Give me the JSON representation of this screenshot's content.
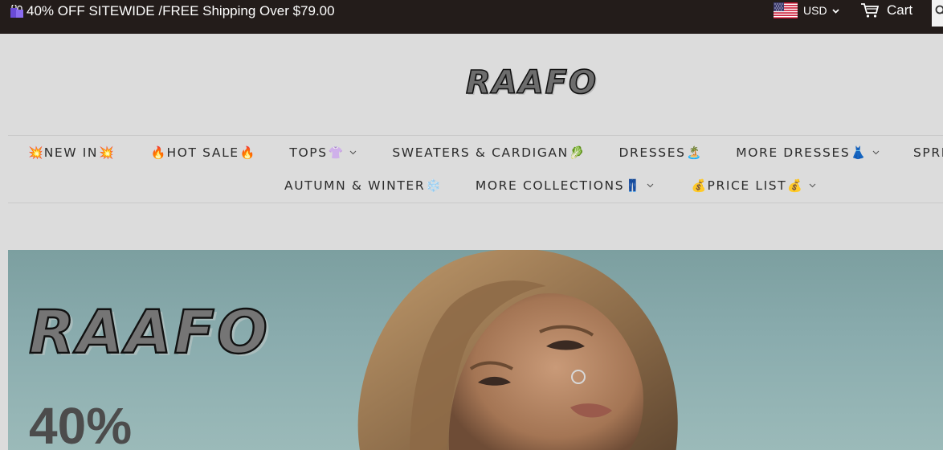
{
  "announcement": {
    "icon": "shopping-bags-icon",
    "text": "40% OFF SITEWIDE /FREE Shipping Over $79.00"
  },
  "currency": {
    "icon": "us-flag-icon",
    "code": "USD"
  },
  "cart": {
    "icon": "cart-icon",
    "label": "Cart"
  },
  "search": {
    "icon": "search-icon"
  },
  "brand": {
    "logo_text": "RAAFO"
  },
  "nav": {
    "row1": [
      {
        "pre": "💥",
        "label": "NEW IN",
        "post": "💥",
        "dropdown": false
      },
      {
        "pre": "🔥",
        "label": "HOT SALE",
        "post": "🔥",
        "dropdown": false
      },
      {
        "pre": "",
        "label": "TOPS",
        "post": "👚",
        "dropdown": true
      },
      {
        "pre": "",
        "label": "SWEATERS & CARDIGAN",
        "post": "🥬",
        "dropdown": false
      },
      {
        "pre": "",
        "label": "DRESSES",
        "post": "🏝️",
        "dropdown": false
      },
      {
        "pre": "",
        "label": "MORE DRESSES",
        "post": "👗",
        "dropdown": true
      },
      {
        "pre": "",
        "label": "SPRING &",
        "post": "",
        "dropdown": false
      }
    ],
    "row2": [
      {
        "pre": "",
        "label": "AUTUMN & WINTER",
        "post": "❄️",
        "dropdown": false
      },
      {
        "pre": "",
        "label": "MORE COLLECTIONS",
        "post": "👖",
        "dropdown": true
      },
      {
        "pre": "💰",
        "label": "PRICE LIST",
        "post": "💰",
        "dropdown": true
      }
    ]
  },
  "hero": {
    "logo_text": "RAAFO",
    "discount_text": "40%"
  },
  "colors": {
    "topbar_bg": "#231c1a",
    "page_bg": "#dcdcdc",
    "nav_text": "#2c2c2c",
    "hero_sky": "#8aacae"
  }
}
